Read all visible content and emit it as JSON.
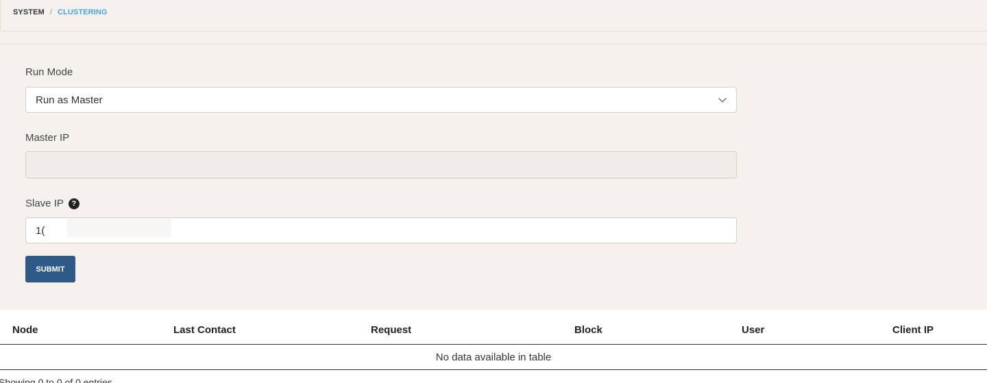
{
  "breadcrumb": {
    "root": "SYSTEM",
    "separator": "/",
    "current": "CLUSTERING"
  },
  "form": {
    "run_mode": {
      "label": "Run Mode",
      "selected": "Run as Master"
    },
    "master_ip": {
      "label": "Master IP",
      "value": ""
    },
    "slave_ip": {
      "label": "Slave IP",
      "help_glyph": "?",
      "value": "1("
    },
    "submit_label": "SUBMIT"
  },
  "table": {
    "columns": [
      "Node",
      "Last Contact",
      "Request",
      "Block",
      "User",
      "Client IP"
    ],
    "empty_message": "No data available in table",
    "info": "Showing 0 to 0 of 0 entries"
  },
  "colors": {
    "background": "#f5f2ed",
    "accent": "#4aa3df",
    "button": "#2f5a87"
  }
}
